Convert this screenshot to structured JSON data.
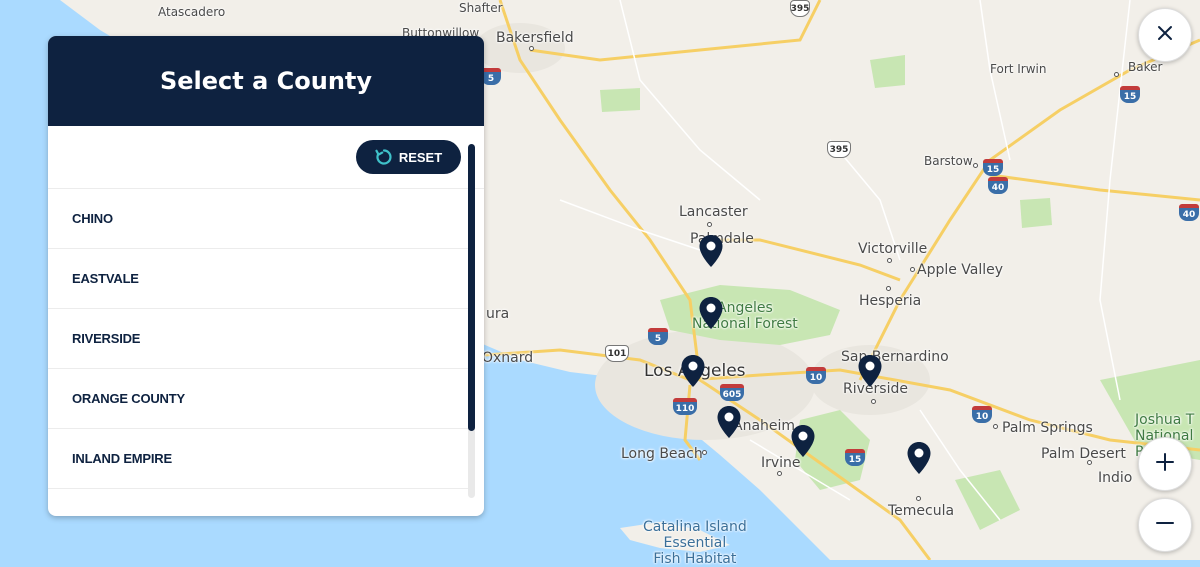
{
  "panel": {
    "title": "Select a County",
    "reset_label": "RESET",
    "counties": [
      "CHINO",
      "EASTVALE",
      "RIVERSIDE",
      "ORANGE COUNTY",
      "INLAND EMPIRE"
    ]
  },
  "map": {
    "places": {
      "atascadero": "Atascadero",
      "shafter": "Shafter",
      "buttonwillow": "Buttonwillow",
      "bakersfield": "Bakersfield",
      "fort_irwin": "Fort Irwin",
      "baker": "Baker",
      "barstow": "Barstow",
      "lancaster": "Lancaster",
      "palmdale": "Palmdale",
      "victorville": "Victorville",
      "apple_valley": "Apple Valley",
      "hesperia": "Hesperia",
      "angeles_nf": "Angeles\nNational Forest",
      "ura": "ura",
      "oxnard": "Oxnard",
      "los_angeles": "Los Angeles",
      "san_bernardino": "San Bernardino",
      "riverside": "Riverside",
      "anaheim": "Anaheim",
      "long_beach": "Long Beach",
      "irvine": "Irvine",
      "palm_springs": "Palm Springs",
      "palm_desert": "Palm Desert",
      "indio": "Indio",
      "joshua_tree": "Joshua T\nNational P",
      "temecula": "Temecula",
      "catalina": "Catalina Island\nEssential\nFish Habitat"
    },
    "shields": {
      "i5_north": "5",
      "us395_top": "395",
      "us395_mid": "395",
      "i15_baker": "15",
      "i15_barstow": "15",
      "i40_barstow": "40",
      "i40_east": "40",
      "i5_la": "5",
      "us101": "101",
      "i605": "605",
      "i110": "110",
      "i10_la": "10",
      "i10_east": "10",
      "i15_south": "15",
      "i10_far": "10"
    },
    "markers": [
      "palmdale",
      "angeles-forest",
      "los-angeles",
      "anaheim",
      "irvine",
      "riverside",
      "temecula"
    ]
  },
  "controls": {
    "close": "close",
    "zoom_in": "zoom in",
    "zoom_out": "zoom out"
  },
  "colors": {
    "navy": "#0e2240",
    "land": "#f2efe9",
    "water": "#aadaff",
    "park": "#c8e6b3",
    "road": "#f6cf65"
  }
}
